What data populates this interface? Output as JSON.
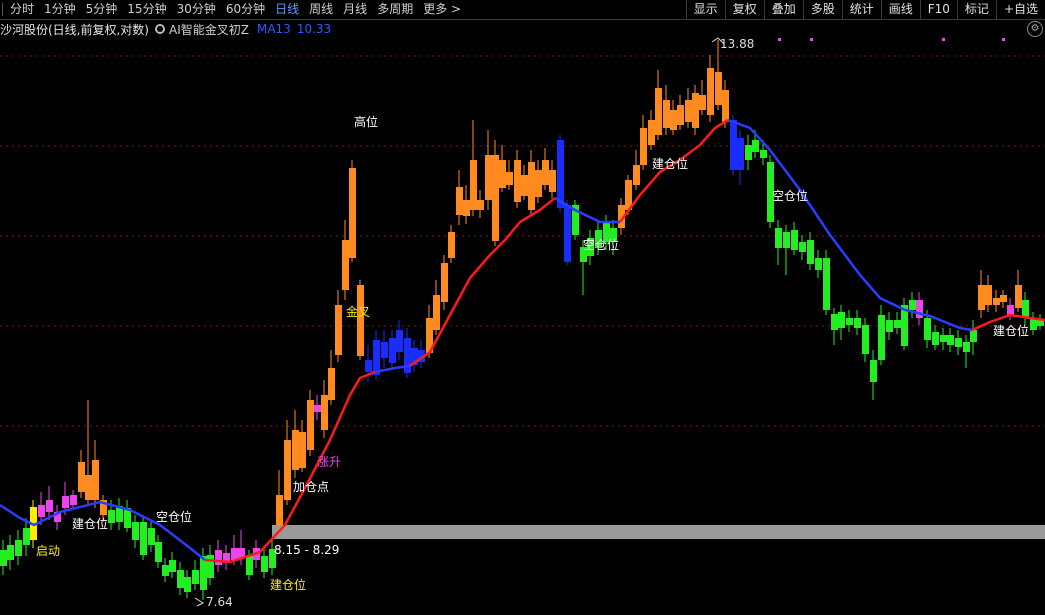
{
  "toolbar": {
    "tabs": [
      "分时",
      "1分钟",
      "5分钟",
      "15分钟",
      "30分钟",
      "60分钟",
      "日线",
      "周线",
      "月线",
      "多周期",
      "更多 >"
    ],
    "active_tab": "日线",
    "tools": [
      "显示",
      "复权",
      "叠加",
      "多股",
      "统计",
      "画线",
      "F10",
      "标记",
      "+自选"
    ]
  },
  "info": {
    "stock": "沙河股份(日线,前复权,对数)",
    "indicator": "AI智能金叉初Z",
    "ma_label": "MA13",
    "ma_value": "10.33"
  },
  "chart_data": {
    "type": "candlestick",
    "high_label": "13.88",
    "low_label": "7.64",
    "band_label": "8.15 - 8.29",
    "annotations": [
      "启动",
      "建仓位",
      "空仓位",
      "建仓位",
      "加仓点",
      "涨升",
      "金叉",
      "高位",
      "空仓位",
      "建仓位",
      "空仓位",
      "建仓位"
    ],
    "colors": {
      "up": "#ff8a1f",
      "down_green": "#22ee22",
      "magenta": "#ee44ee",
      "blue": "#1a2dff",
      "yellow": "#ffee00",
      "ma_up": "#ff1a1a",
      "ma_down": "#2a3cff"
    }
  }
}
